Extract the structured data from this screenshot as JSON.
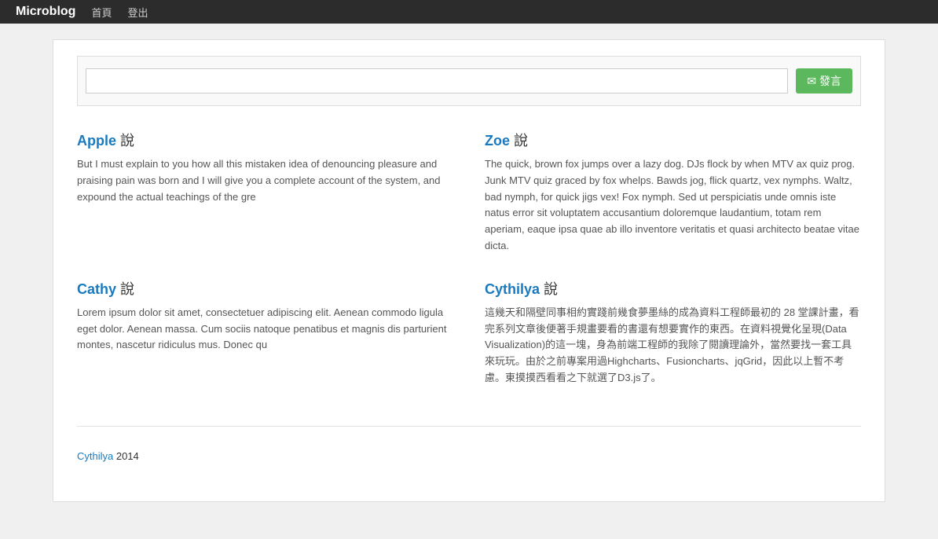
{
  "navbar": {
    "brand": "Microblog",
    "links": [
      {
        "label": "首頁",
        "name": "nav-home"
      },
      {
        "label": "登出",
        "name": "nav-logout"
      }
    ]
  },
  "form": {
    "placeholder": "",
    "button_label": "✉ 發言"
  },
  "posts": [
    {
      "id": "apple",
      "author": "Apple",
      "said": "說",
      "content": "But I must explain to you how all this mistaken idea of denouncing pleasure and praising pain was born and I will give you a complete account of the system, and expound the actual teachings of the gre"
    },
    {
      "id": "zoe",
      "author": "Zoe",
      "said": "說",
      "content": "The quick, brown fox jumps over a lazy dog. DJs flock by when MTV ax quiz prog. Junk MTV quiz graced by fox whelps. Bawds jog, flick quartz, vex nymphs. Waltz, bad nymph, for quick jigs vex! Fox nymph. Sed ut perspiciatis unde omnis iste natus error sit voluptatem accusantium doloremque laudantium, totam rem aperiam, eaque ipsa quae ab illo inventore veritatis et quasi architecto beatae vitae dicta."
    },
    {
      "id": "cathy",
      "author": "Cathy",
      "said": "說",
      "content": "Lorem ipsum dolor sit amet, consectetuer adipiscing elit. Aenean commodo ligula eget dolor. Aenean massa. Cum sociis natoque penatibus et magnis dis parturient montes, nascetur ridiculus mus. Donec qu"
    },
    {
      "id": "cythilya",
      "author": "Cythilya",
      "said": "說",
      "content": "這幾天和隔壁同事相約實踐前幾食夢墨絲的成為資料工程師最初的 28 堂課計畫，看完系列文章後便著手規畫要看的書還有想要實作的東西。在資料視覺化呈現(Data Visualization)的這一塊，身為前端工程師的我除了閱讀理論外，當然要找一套工具來玩玩。由於之前專案用過Highcharts、Fusioncharts、jqGrid，因此以上暫不考慮。東摸摸西看看之下就選了D3.js了。"
    }
  ],
  "footer": {
    "author": "Cythilya",
    "year": " 2014"
  }
}
